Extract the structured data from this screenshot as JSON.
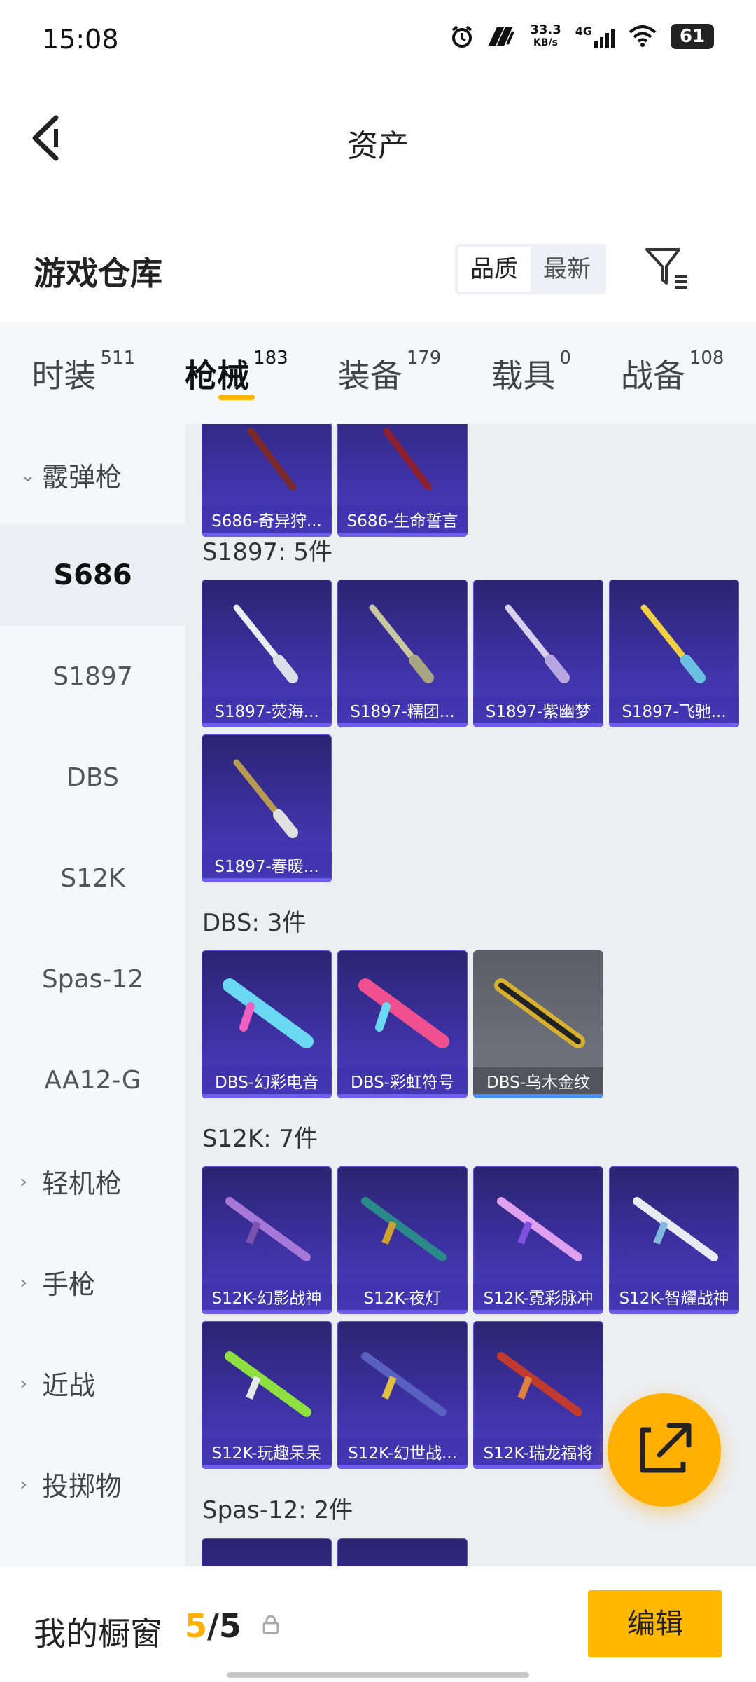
{
  "status_bar": {
    "time": "15:08",
    "net_speed_value": "33.3",
    "net_speed_unit": "KB/s",
    "network": "4G",
    "battery": "61"
  },
  "nav": {
    "title": "资产"
  },
  "warehouse": {
    "title": "游戏仓库",
    "sort_options": [
      "品质",
      "最新"
    ],
    "sort_selected": "品质"
  },
  "tabs": [
    {
      "label": "时装",
      "count": "511"
    },
    {
      "label": "枪械",
      "count": "183",
      "active": true
    },
    {
      "label": "装备",
      "count": "179"
    },
    {
      "label": "载具",
      "count": "0"
    },
    {
      "label": "战备",
      "count": "108"
    }
  ],
  "sidebar": {
    "group_shotgun": "霰弹枪",
    "subs": [
      "S686",
      "S1897",
      "DBS",
      "S12K",
      "Spas-12",
      "AA12-G"
    ],
    "active_sub": "S686",
    "group_lmg": "轻机枪",
    "group_pistol": "手枪",
    "group_melee": "近战",
    "group_throw": "投掷物"
  },
  "sections": {
    "s686_items": [
      "S686-奇异狩...",
      "S686-生命誓言"
    ],
    "s1897_label": "S1897: 5件",
    "s1897_items": [
      "S1897-荧海...",
      "S1897-糯团...",
      "S1897-紫幽梦",
      "S1897-飞驰...",
      "S1897-春暖..."
    ],
    "dbs_label": "DBS: 3件",
    "dbs_items": [
      "DBS-幻彩电音",
      "DBS-彩虹符号",
      "DBS-乌木金纹"
    ],
    "s12k_label": "S12K: 7件",
    "s12k_items": [
      "S12K-幻影战神",
      "S12K-夜灯",
      "S12K-霓彩脉冲",
      "S12K-智耀战神",
      "S12K-玩趣呆呆",
      "S12K-幻世战...",
      "S12K-瑞龙福将"
    ],
    "spas_label": "Spas-12: 2件"
  },
  "bottom": {
    "title": "我的橱窗",
    "count_current": "5",
    "count_sep": "/",
    "count_total": "5",
    "edit_label": "编辑"
  },
  "colors": {
    "accent": "#ffb000",
    "card_purple": "#3d31a3"
  }
}
